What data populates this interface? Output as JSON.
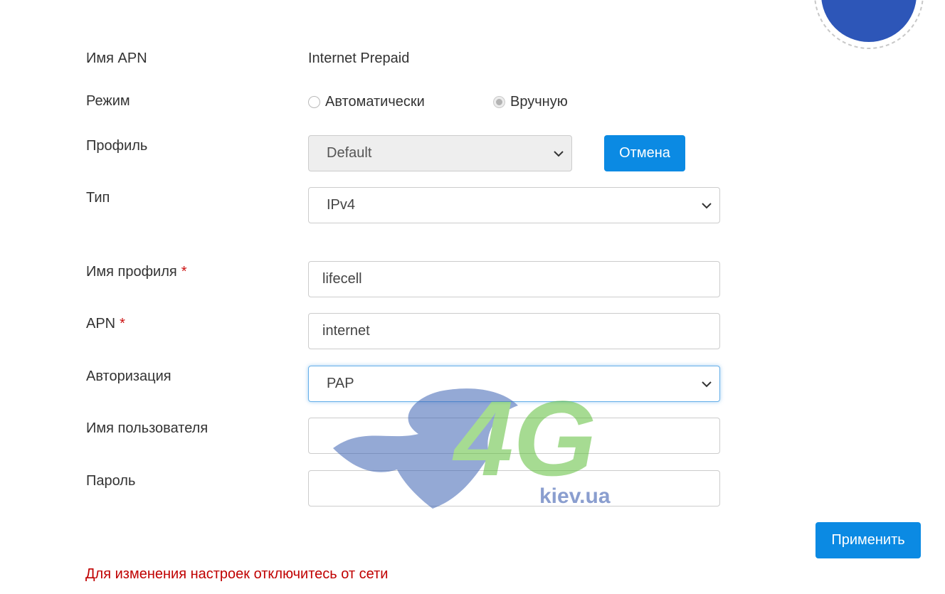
{
  "apn_name": {
    "label": "Имя APN",
    "value": "Internet Prepaid"
  },
  "mode": {
    "label": "Режим",
    "options": [
      {
        "label": "Автоматически",
        "checked": false
      },
      {
        "label": "Вручную",
        "checked": true
      }
    ]
  },
  "profile": {
    "label": "Профиль",
    "selected": "Default",
    "cancel_label": "Отмена"
  },
  "type": {
    "label": "Тип",
    "selected": "IPv4"
  },
  "profile_name": {
    "label": "Имя профиля",
    "required_mark": "*",
    "value": "lifecell"
  },
  "apn": {
    "label": "APN",
    "required_mark": "*",
    "value": "internet"
  },
  "auth": {
    "label": "Авторизация",
    "selected": "PAP"
  },
  "username": {
    "label": "Имя пользователя",
    "value": ""
  },
  "password": {
    "label": "Пароль",
    "value": ""
  },
  "apply_label": "Применить",
  "warning": "Для изменения настроек отключитесь от сети",
  "watermark": {
    "text": "4G",
    "subtext": "kiev.ua"
  },
  "icons": {
    "settings": "gear-icon",
    "dropdown": "chevron-down-icon"
  },
  "colors": {
    "primary": "#0b8ae3",
    "warning": "#c00000",
    "gear_bg": "#2d56b8",
    "required": "#cc1111"
  }
}
